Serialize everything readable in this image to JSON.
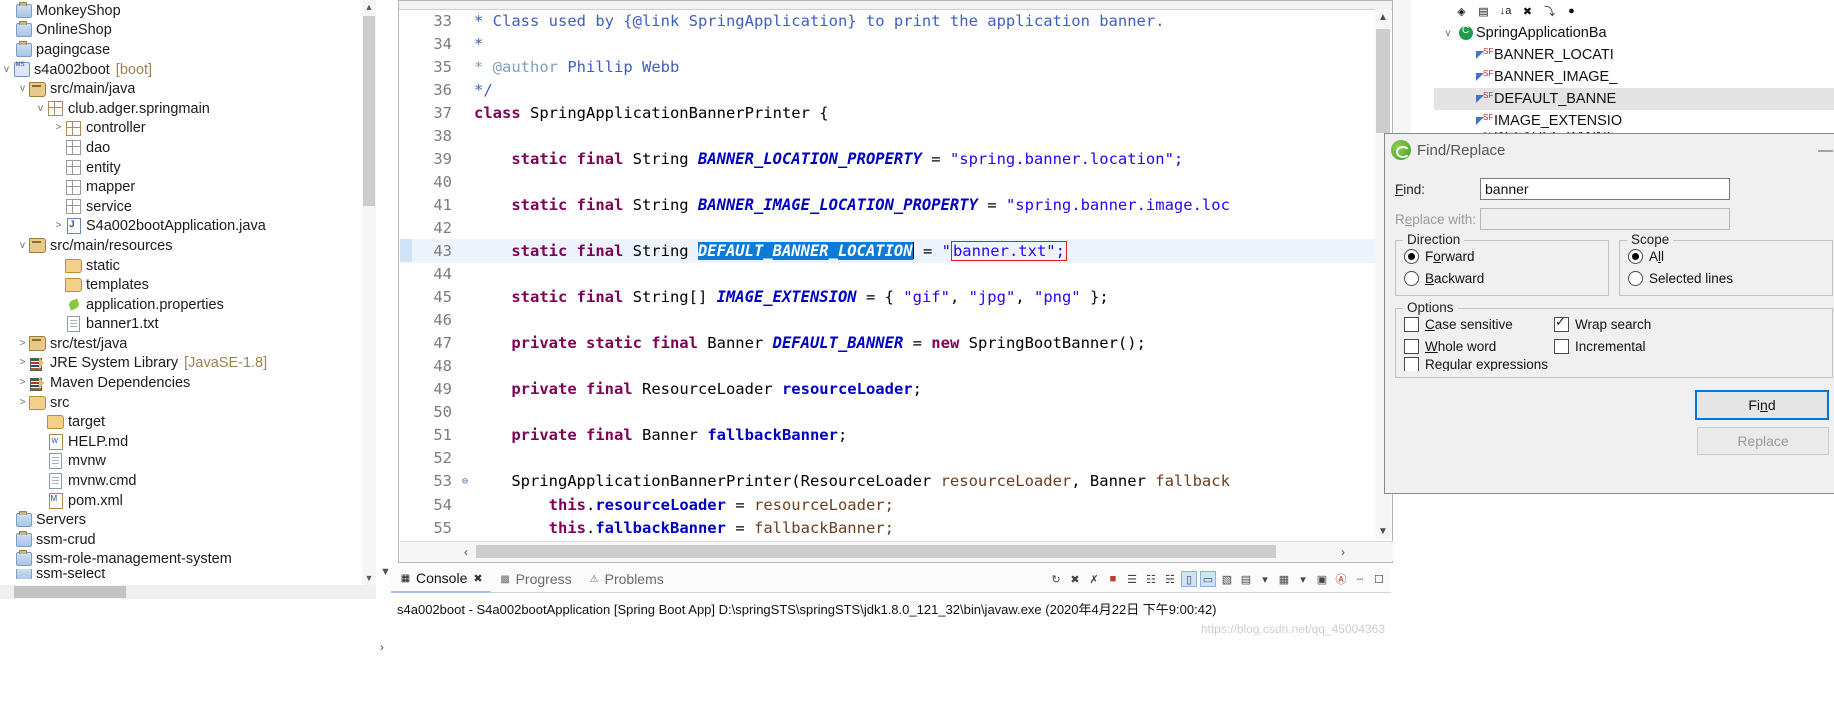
{
  "explorer": {
    "items": [
      {
        "label": "MonkeyShop",
        "icon": "project-icon",
        "indent": 1,
        "arrow": "",
        "suffix": ""
      },
      {
        "label": "OnlineShop",
        "icon": "project-icon",
        "indent": 1,
        "arrow": "",
        "suffix": ""
      },
      {
        "label": "pagingcase",
        "icon": "project-icon",
        "indent": 1,
        "arrow": "",
        "suffix": ""
      },
      {
        "label": "s4a002boot",
        "icon": "spring-boot-project-icon",
        "indent": 1,
        "arrow": "v",
        "suffix": "[boot]"
      },
      {
        "label": "src/main/java",
        "icon": "source-folder-icon",
        "indent": 2,
        "arrow": "v",
        "suffix": ""
      },
      {
        "label": "club.adger.springmain",
        "icon": "package-icon",
        "indent": 3,
        "arrow": "v",
        "suffix": ""
      },
      {
        "label": "controller",
        "icon": "package-icon",
        "indent": 4,
        "arrow": ">",
        "suffix": ""
      },
      {
        "label": "dao",
        "icon": "package-empty-icon",
        "indent": 4,
        "arrow": "",
        "suffix": ""
      },
      {
        "label": "entity",
        "icon": "package-empty-icon",
        "indent": 4,
        "arrow": "",
        "suffix": ""
      },
      {
        "label": "mapper",
        "icon": "package-empty-icon",
        "indent": 4,
        "arrow": "",
        "suffix": ""
      },
      {
        "label": "service",
        "icon": "package-empty-icon",
        "indent": 4,
        "arrow": "",
        "suffix": ""
      },
      {
        "label": "S4a002bootApplication.java",
        "icon": "java-file-icon",
        "indent": 4,
        "arrow": ">",
        "suffix": ""
      },
      {
        "label": "src/main/resources",
        "icon": "source-folder-icon",
        "indent": 2,
        "arrow": "v",
        "suffix": ""
      },
      {
        "label": "static",
        "icon": "folder-icon",
        "indent": 3,
        "arrow": "",
        "suffix": ""
      },
      {
        "label": "templates",
        "icon": "folder-icon",
        "indent": 3,
        "arrow": "",
        "suffix": ""
      },
      {
        "label": "application.properties",
        "icon": "properties-icon",
        "indent": 3,
        "arrow": "",
        "suffix": ""
      },
      {
        "label": "banner1.txt",
        "icon": "text-file-icon",
        "indent": 3,
        "arrow": "",
        "suffix": ""
      },
      {
        "label": "src/test/java",
        "icon": "source-folder-icon",
        "indent": 2,
        "arrow": ">",
        "suffix": ""
      },
      {
        "label": "JRE System Library",
        "icon": "library-icon",
        "indent": 2,
        "arrow": ">",
        "suffix": "[JavaSE-1.8]"
      },
      {
        "label": "Maven Dependencies",
        "icon": "library-icon",
        "indent": 2,
        "arrow": ">",
        "suffix": ""
      },
      {
        "label": "src",
        "icon": "folder-icon",
        "indent": 2,
        "arrow": ">",
        "suffix": ""
      },
      {
        "label": "target",
        "icon": "folder-icon",
        "indent": 3,
        "arrow": "",
        "suffix": ""
      },
      {
        "label": "HELP.md",
        "icon": "markdown-file-icon",
        "indent": 3,
        "arrow": "",
        "suffix": ""
      },
      {
        "label": "mvnw",
        "icon": "text-file-icon",
        "indent": 3,
        "arrow": "",
        "suffix": ""
      },
      {
        "label": "mvnw.cmd",
        "icon": "text-file-icon",
        "indent": 3,
        "arrow": "",
        "suffix": ""
      },
      {
        "label": "pom.xml",
        "icon": "xml-file-icon",
        "indent": 3,
        "arrow": "",
        "suffix": ""
      },
      {
        "label": "Servers",
        "icon": "project-icon",
        "indent": 1,
        "arrow": "",
        "suffix": ""
      },
      {
        "label": "ssm-crud",
        "icon": "project-icon",
        "indent": 1,
        "arrow": "",
        "suffix": ""
      },
      {
        "label": "ssm-role-management-system",
        "icon": "project-icon",
        "indent": 1,
        "arrow": "",
        "suffix": ""
      },
      {
        "label": "ssm-select",
        "icon": "project-icon",
        "indent": 1,
        "arrow": "",
        "suffix": ""
      }
    ]
  },
  "editor": {
    "lines": [
      {
        "num": "33",
        "fold": "",
        "hl": false
      },
      {
        "num": "34",
        "fold": "",
        "hl": false
      },
      {
        "num": "35",
        "fold": "",
        "hl": false
      },
      {
        "num": "36",
        "fold": "",
        "hl": false
      },
      {
        "num": "37",
        "fold": "",
        "hl": false
      },
      {
        "num": "38",
        "fold": "",
        "hl": false
      },
      {
        "num": "39",
        "fold": "",
        "hl": false
      },
      {
        "num": "40",
        "fold": "",
        "hl": false
      },
      {
        "num": "41",
        "fold": "",
        "hl": false
      },
      {
        "num": "42",
        "fold": "",
        "hl": false
      },
      {
        "num": "43",
        "fold": "",
        "hl": true
      },
      {
        "num": "44",
        "fold": "",
        "hl": false
      },
      {
        "num": "45",
        "fold": "",
        "hl": false
      },
      {
        "num": "46",
        "fold": "",
        "hl": false
      },
      {
        "num": "47",
        "fold": "",
        "hl": false
      },
      {
        "num": "48",
        "fold": "",
        "hl": false
      },
      {
        "num": "49",
        "fold": "",
        "hl": false
      },
      {
        "num": "50",
        "fold": "",
        "hl": false
      },
      {
        "num": "51",
        "fold": "",
        "hl": false
      },
      {
        "num": "52",
        "fold": "",
        "hl": false
      },
      {
        "num": "53",
        "fold": "⊖",
        "hl": false
      },
      {
        "num": "54",
        "fold": "",
        "hl": false
      },
      {
        "num": "55",
        "fold": "",
        "hl": false
      }
    ],
    "text": {
      "l33": "* Class used by {@link SpringApplication} to print the application banner.",
      "l34": "*",
      "l35_a": "* @author",
      "l35_b": " Phillip Webb",
      "l36": "*/",
      "l37_k": "class",
      "l37_rest": " SpringApplicationBannerPrinter {",
      "l39_k": "static final",
      "l39_t": " String ",
      "l39_f": "BANNER_LOCATION_PROPERTY",
      "l39_eq": " = ",
      "l39_s": "\"spring.banner.location\";",
      "l41_f": "BANNER_IMAGE_LOCATION_PROPERTY",
      "l41_s": "\"spring.banner.image.loc",
      "l43_f": "DEFAULT_BANNER_LOCATION",
      "l43_q": "\"",
      "l43_s": "banner.txt\";",
      "l45_t": " String[] ",
      "l45_f": "IMAGE_EXTENSION",
      "l45_rest1": " = { ",
      "l45_s1": "\"gif\"",
      "l45_c1": ", ",
      "l45_s2": "\"jpg\"",
      "l45_c2": ", ",
      "l45_s3": "\"png\"",
      "l45_end": " };",
      "l47_k": "private static final",
      "l47_t": " Banner ",
      "l47_f": "DEFAULT_BANNER",
      "l47_eq": " = ",
      "l47_new": "new",
      "l47_rest": " SpringBootBanner();",
      "l49_k": "private final",
      "l49_t": " ResourceLoader ",
      "l49_v": "resourceLoader",
      "l49_end": ";",
      "l51_t": " Banner ",
      "l51_v": "fallbackBanner",
      "l51_end": ";",
      "l53_a": "SpringApplicationBannerPrinter(ResourceLoader ",
      "l53_p1": "resourceLoader",
      "l53_b": ", Banner ",
      "l53_p2": "fallback",
      "l54_this": "this",
      "l54_dot": ".",
      "l54_f": "resourceLoader",
      "l54_eq": " = ",
      "l54_v": "resourceLoader;",
      "l55_f": "fallbackBanner",
      "l55_v": "fallbackBanner;"
    }
  },
  "outline": {
    "toolbar_icons": [
      "hierarchy-icon",
      "collapse-all-icon",
      "sort-icon",
      "hide-fields-icon",
      "hide-static-icon",
      "hide-nonpublic-icon"
    ],
    "items": [
      {
        "label": "SpringApplicationBa",
        "icon": "class-icon",
        "arrow": "v",
        "indent": 0,
        "selected": false
      },
      {
        "label": "BANNER_LOCATI",
        "icon": "static-field-icon",
        "arrow": "",
        "indent": 1,
        "selected": false
      },
      {
        "label": "BANNER_IMAGE_",
        "icon": "static-field-icon",
        "arrow": "",
        "indent": 1,
        "selected": false
      },
      {
        "label": "DEFAULT_BANNE",
        "icon": "static-field-icon",
        "arrow": "",
        "indent": 1,
        "selected": true
      },
      {
        "label": "IMAGE_EXTENSIO",
        "icon": "static-field-icon",
        "arrow": "",
        "indent": 1,
        "selected": false
      },
      {
        "label": "DEFAULT_BANNE",
        "icon": "static-field-icon",
        "arrow": "",
        "indent": 1,
        "selected": false
      }
    ]
  },
  "find_dialog": {
    "title": "Find/Replace",
    "minimize_glyph": "—",
    "find_label": "Find:",
    "find_value": "banner",
    "replace_label": "Replace with:",
    "replace_value": "",
    "direction": {
      "title": "Direction",
      "options": [
        {
          "label": "Forward",
          "checked": true
        },
        {
          "label": "Backward",
          "checked": false
        }
      ]
    },
    "scope": {
      "title": "Scope",
      "options": [
        {
          "label": "All",
          "checked": true
        },
        {
          "label": "Selected lines",
          "checked": false
        }
      ]
    },
    "options": {
      "title": "Options",
      "items": [
        {
          "label": "Case sensitive",
          "checked": false
        },
        {
          "label": "Wrap search",
          "checked": true
        },
        {
          "label": "Whole word",
          "checked": false
        },
        {
          "label": "Incremental",
          "checked": false
        },
        {
          "label": "Regular expressions",
          "checked": false
        }
      ]
    },
    "buttons": [
      {
        "label": "Find",
        "primary": true,
        "disabled": false
      },
      {
        "label": "Replace",
        "primary": false,
        "disabled": true
      }
    ]
  },
  "console": {
    "tabs": [
      {
        "label": "Console",
        "active": true,
        "icon": "console-icon",
        "closable": true
      },
      {
        "label": "Progress",
        "active": false,
        "icon": "progress-icon",
        "closable": false
      },
      {
        "label": "Problems",
        "active": false,
        "icon": "problems-icon",
        "closable": false
      }
    ],
    "toolbar_icons": [
      "terminate-all-icon",
      "remove-launch-icon",
      "remove-all-launches-icon",
      "terminate-icon",
      "clear-console-icon",
      "scroll-lock-icon",
      "word-wrap-icon",
      "show-console-icon",
      "pin-console-icon",
      "display-selected-console-icon",
      "open-console-icon",
      "link-icon",
      "minimize-icon",
      "maximize-icon"
    ],
    "status_line": "s4a002boot - S4a002bootApplication [Spring Boot App] D:\\springSTS\\springSTS\\jdk1.8.0_121_32\\bin\\javaw.exe (2020年4月22日 下午9:00:42)",
    "watermark": "https://blog.csdn.net/qq_45004363"
  },
  "colors": {
    "accent": "#0078d7",
    "selection": "#0c7ad6",
    "highlight_line": "#eef4fd",
    "string": "#2a00ff",
    "keyword": "#7f0055",
    "comment": "#3f5fbf",
    "field": "#0000c0",
    "box_outline": "#e01b1b"
  }
}
